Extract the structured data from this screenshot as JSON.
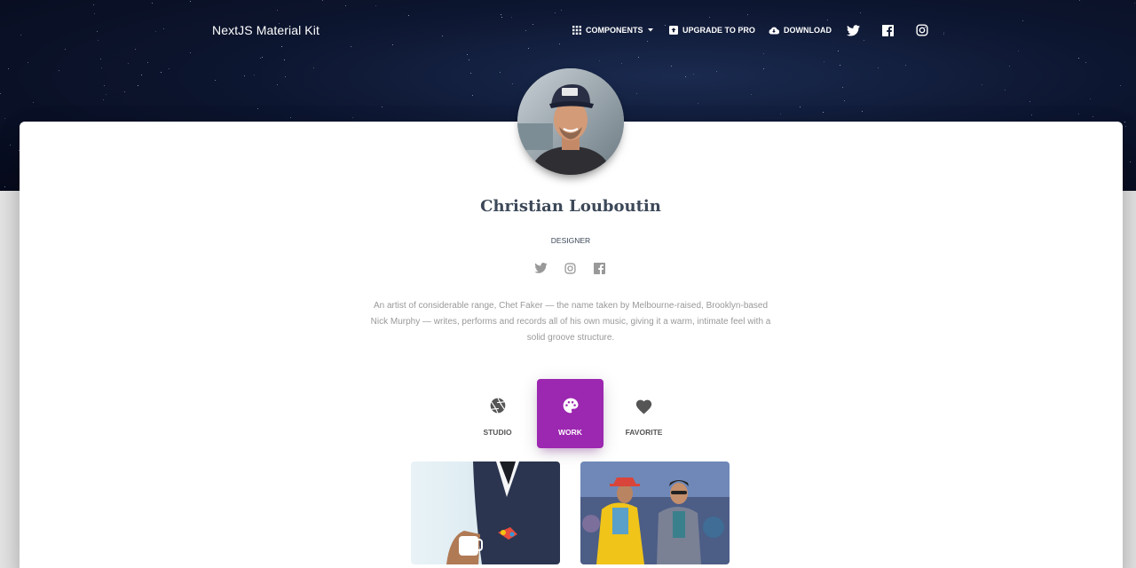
{
  "navbar": {
    "brand": "NextJS Material Kit",
    "items": [
      {
        "label": "Components",
        "icon": "apps-grid-icon",
        "has_dropdown": true
      },
      {
        "label": "Upgrade to pro",
        "icon": "unarchive-icon"
      },
      {
        "label": "Download",
        "icon": "cloud-download-icon"
      }
    ],
    "social": [
      "twitter-icon",
      "facebook-icon",
      "instagram-icon"
    ]
  },
  "profile": {
    "name": "Christian Louboutin",
    "title": "DESIGNER",
    "social": [
      "twitter-icon",
      "instagram-icon",
      "facebook-icon"
    ],
    "description": "An artist of considerable range, Chet Faker — the name taken by Melbourne-raised, Brooklyn-based Nick Murphy — writes, performs and records all of his own music, giving it a warm, intimate feel with a solid groove structure."
  },
  "tabs": [
    {
      "label": "Studio",
      "icon": "camera-shutter-icon",
      "active": false
    },
    {
      "label": "Work",
      "icon": "palette-icon",
      "active": true
    },
    {
      "label": "Favorite",
      "icon": "heart-icon",
      "active": false
    }
  ],
  "colors": {
    "accent": "#9c27b0",
    "hero_bg": "#0d1630",
    "text": "#3c4858",
    "muted": "#999999"
  }
}
